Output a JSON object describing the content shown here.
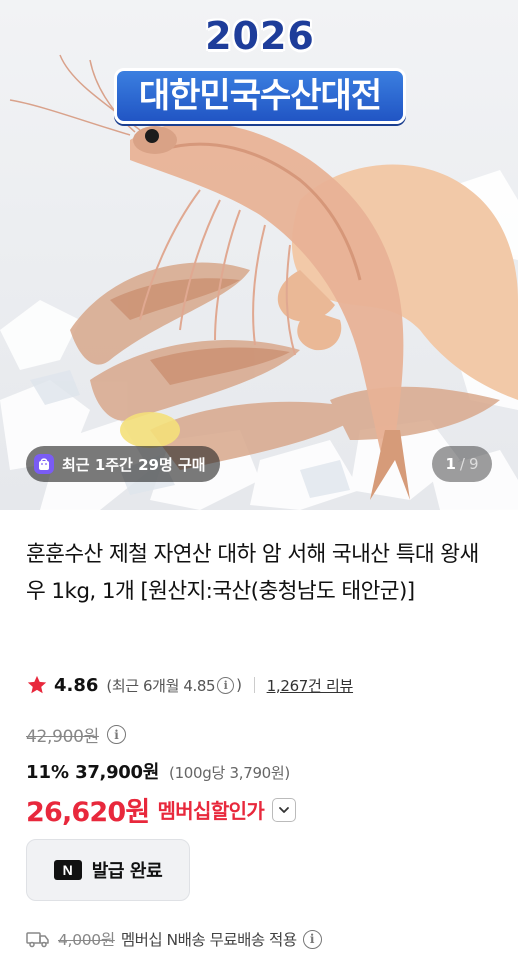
{
  "hero": {
    "banner_year": "2026",
    "banner_title": "대한민국수산대전",
    "recent_purchase": "최근 1주간 29명 구매",
    "page_current": "1",
    "page_separator": "/",
    "page_total": "9"
  },
  "product": {
    "title": "훈훈수산 제철 자연산 대하 암 서해 국내산 특대 왕새우 1kg, 1개 [원산지:국산(충청남도 태안군)]",
    "rating": "4.86",
    "rating_recent": "(최근 6개월 4.85",
    "rating_recent_close": ")",
    "review_count": "1,267건 리뷰"
  },
  "price": {
    "original": "42,900원",
    "discount_rate": "11%",
    "discount_price": "37,900원",
    "unit_price": "(100g당 3,790원)",
    "member_price": "26,620원",
    "member_label": "멤버십할인가"
  },
  "coupon": {
    "n_mark": "N",
    "label": "발급 완료"
  },
  "shipping": {
    "original_fee": "4,000원",
    "text": "멤버십 N배송 무료배송 적용"
  },
  "colors": {
    "member_red": "#e8283c",
    "badge_purple": "#7a5cf5",
    "star_red": "#e8283c"
  },
  "icons": [
    "bag-icon",
    "star-icon",
    "info-icon",
    "chevron-down-icon",
    "n-logo-icon",
    "truck-icon"
  ]
}
